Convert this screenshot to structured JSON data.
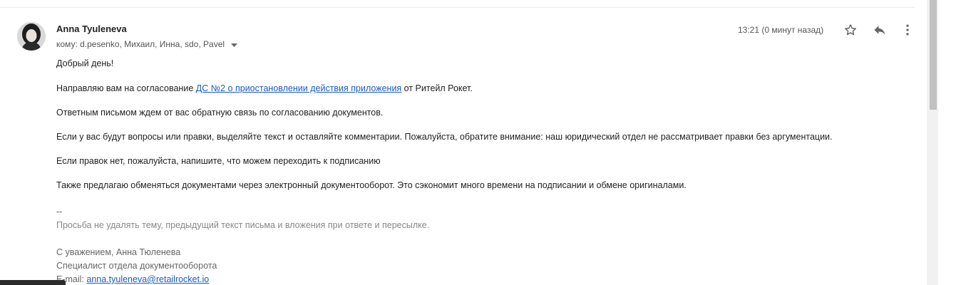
{
  "email": {
    "sender_name": "Anna Tyuleneva",
    "recipients_prefix": "кому:",
    "recipients": "d.pesenko, Михаил, Инна, sdo, Pavel",
    "timestamp": "13:21 (0 минут назад)",
    "icons": {
      "avatar": "avatar",
      "recipients_dropdown": "chevron-down-icon",
      "star": "star-icon",
      "reply": "reply-icon",
      "more": "more-vert-icon"
    },
    "body": {
      "greeting": "Добрый день!",
      "p1_before": "Направляю вам на согласование ",
      "p1_link": "ДС №2 о приостановлении действия приложения",
      "p1_after": " от Ритейл Рокет.",
      "p2": "Ответным письмом ждем от вас обратную связь по согласованию документов.",
      "p3": "Если у вас будут вопросы или правки, выделяйте текст и оставляйте комментарии. Пожалуйста, обратите внимание: наш юридический отдел не рассматривает правки без аргументации.",
      "p4": "Если правок нет, пожалуйста, напишите, что можем переходить к подписанию",
      "p5": "Также  предлагаю обменяться документами  через электронный документооборот.  Это сэкономит много времени на подписании и обмене оригиналами."
    },
    "signature": {
      "separator": "--",
      "notice": "Просьба не удалять тему, предыдущий текст письма и вложения при ответе и пересылке.",
      "regards": "С уважением, Анна Тюленева",
      "position": "Специалист отдела документооборота",
      "email_label": "E-mail: ",
      "email_value": "anna.tyuleneva@retailrocket.io"
    }
  },
  "colors": {
    "link": "#1a5bc4",
    "text": "#222222",
    "muted": "#666666"
  }
}
